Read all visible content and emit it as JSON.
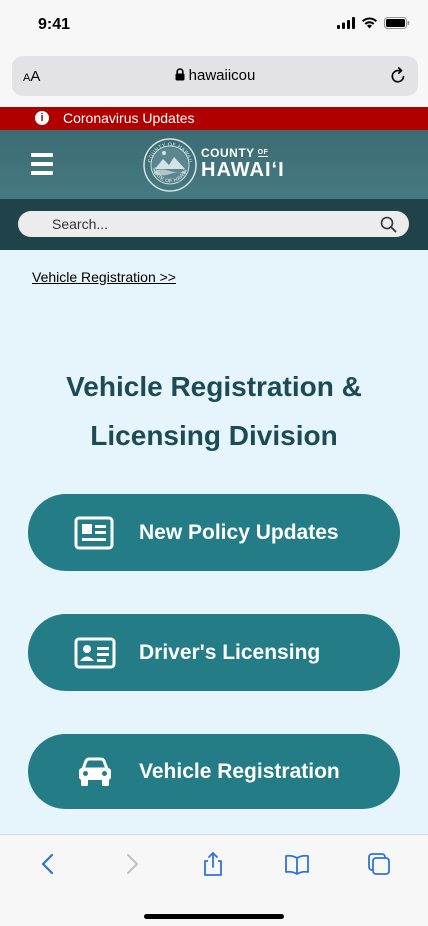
{
  "status": {
    "time": "9:41"
  },
  "browser": {
    "text_size_label": "AA",
    "url": "hawaiicou",
    "icons": [
      "lock-icon",
      "reload-icon",
      "signal-icon",
      "wifi-icon",
      "battery-icon"
    ]
  },
  "alert": {
    "text": "Coronavirus Updates",
    "icon": "info-icon"
  },
  "header": {
    "logo_line1": "COUNTY",
    "logo_of": "OF",
    "logo_line2": "HAWAIʻI",
    "seal_top_text": "COUNTY OF HAWAII",
    "seal_bottom_text": "STATE OF HAWAII"
  },
  "search": {
    "placeholder": "Search..."
  },
  "breadcrumb": {
    "label": "Vehicle Registration >>"
  },
  "page": {
    "title_line1": "Vehicle Registration &",
    "title_line2": "Licensing Division"
  },
  "nav_buttons": [
    {
      "label": "New Policy Updates",
      "icon": "id-card-icon"
    },
    {
      "label": "Driver's Licensing",
      "icon": "drivers-license-icon"
    },
    {
      "label": "Vehicle Registration",
      "icon": "car-icon"
    }
  ],
  "colors": {
    "alert": "#b00000",
    "header": "#467a81",
    "search_bar": "#1f4349",
    "content_bg": "#e6f4fb",
    "title": "#1c4b55",
    "button": "#237c86",
    "ios_blue": "#2f73d8"
  }
}
